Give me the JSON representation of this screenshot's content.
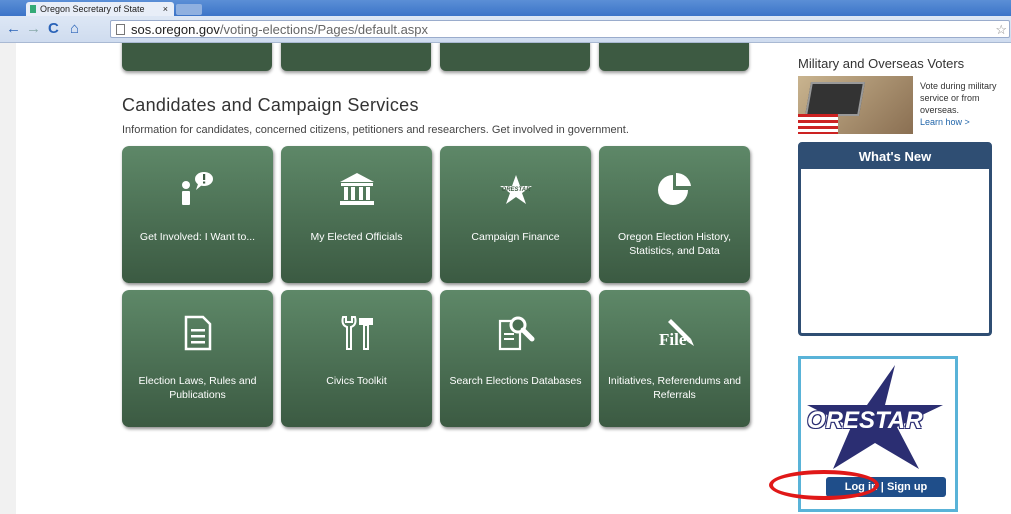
{
  "browser": {
    "tab_title": "Oregon Secretary of State",
    "tab_close": "×",
    "url_host": "sos.oregon.gov",
    "url_path": "/voting-elections/Pages/default.aspx",
    "back": "←",
    "forward": "→",
    "reload": "C",
    "home": "⌂",
    "bookmark": "☆"
  },
  "main": {
    "section_title": "Candidates and Campaign Services",
    "section_subtitle": "Information for candidates, concerned citizens, petitioners and researchers. Get involved in government.",
    "tiles": [
      {
        "label": "Get Involved: I Want to...",
        "icon": "person-alert-icon"
      },
      {
        "label": "My Elected Officials",
        "icon": "capitol-building-icon"
      },
      {
        "label": "Campaign Finance",
        "icon": "orestar-star-icon"
      },
      {
        "label": "Oregon Election History, Statistics, and Data",
        "icon": "pie-chart-icon"
      },
      {
        "label": "Election Laws, Rules and Publications",
        "icon": "document-icon"
      },
      {
        "label": "Civics Toolkit",
        "icon": "tools-icon"
      },
      {
        "label": "Search Elections Databases",
        "icon": "search-document-icon"
      },
      {
        "label": "Initiatives, Referendums and Referrals",
        "icon": "file-pen-icon"
      }
    ]
  },
  "sidebar": {
    "military_title": "Military and Overseas Voters",
    "military_text": "Vote during military service or from overseas.",
    "military_link": "Learn how >",
    "whats_new_title": "What's New",
    "orestar_logo": "ORESTAR",
    "login_label": "Log in",
    "separator": "|",
    "signup_label": "Sign up"
  },
  "colors": {
    "tile_green": "#4a6e52",
    "header_blue": "#2f4e73",
    "orestar_border": "#59b3d8",
    "annotation_red": "#e01818"
  }
}
